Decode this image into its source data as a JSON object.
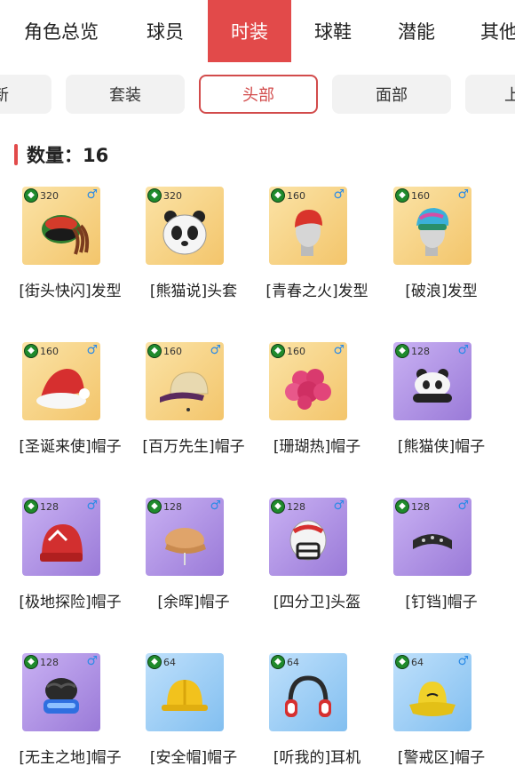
{
  "top_tabs": [
    {
      "label": "角色总览",
      "active": false
    },
    {
      "label": "球员",
      "active": false
    },
    {
      "label": "时装",
      "active": true
    },
    {
      "label": "球鞋",
      "active": false
    },
    {
      "label": "潜能",
      "active": false
    },
    {
      "label": "其他",
      "active": false
    }
  ],
  "sub_tabs": [
    {
      "label": "新",
      "active": false
    },
    {
      "label": "套装",
      "active": false
    },
    {
      "label": "头部",
      "active": true
    },
    {
      "label": "面部",
      "active": false
    },
    {
      "label": "上",
      "active": false
    }
  ],
  "count_label": "数量：16",
  "items": [
    {
      "name": "[街头快闪]发型",
      "points": "320",
      "rarity": "gold",
      "icon": "dreadlocks-hair-icon"
    },
    {
      "name": "[熊猫说]头套",
      "points": "320",
      "rarity": "gold",
      "icon": "panda-mask-icon"
    },
    {
      "name": "[青春之火]发型",
      "points": "160",
      "rarity": "gold",
      "icon": "red-hair-icon"
    },
    {
      "name": "[破浪]发型",
      "points": "160",
      "rarity": "gold",
      "icon": "wave-hair-icon"
    },
    {
      "name": "[圣诞来使]帽子",
      "points": "160",
      "rarity": "gold",
      "icon": "santa-hat-icon"
    },
    {
      "name": "[百万先生]帽子",
      "points": "160",
      "rarity": "gold",
      "icon": "cap-icon"
    },
    {
      "name": "[珊瑚热]帽子",
      "points": "160",
      "rarity": "gold",
      "icon": "coral-hat-icon"
    },
    {
      "name": "[熊猫侠]帽子",
      "points": "128",
      "rarity": "purple",
      "icon": "panda-hat-icon"
    },
    {
      "name": "[极地探险]帽子",
      "points": "128",
      "rarity": "purple",
      "icon": "beanie-icon"
    },
    {
      "name": "[余晖]帽子",
      "points": "128",
      "rarity": "purple",
      "icon": "flat-cap-icon"
    },
    {
      "name": "[四分卫]头盔",
      "points": "128",
      "rarity": "purple",
      "icon": "football-helmet-icon"
    },
    {
      "name": "[钉铛]帽子",
      "points": "128",
      "rarity": "purple",
      "icon": "headband-icon"
    },
    {
      "name": "[无主之地]帽子",
      "points": "128",
      "rarity": "purple",
      "icon": "visor-hat-icon"
    },
    {
      "name": "[安全帽]帽子",
      "points": "64",
      "rarity": "blue",
      "icon": "hard-hat-icon"
    },
    {
      "name": "[听我的]耳机",
      "points": "64",
      "rarity": "blue",
      "icon": "headphones-icon"
    },
    {
      "name": "[警戒区]帽子",
      "points": "64",
      "rarity": "blue",
      "icon": "bucket-hat-icon"
    }
  ],
  "badge_glyph": "◆",
  "gender_glyph": "♂",
  "colors": {
    "accent": "#e24a4a",
    "gold": "#f3c56b",
    "purple": "#9a7ad8",
    "blue": "#82bff0",
    "gender": "#2c8be6",
    "badge": "#1f8a2c"
  }
}
